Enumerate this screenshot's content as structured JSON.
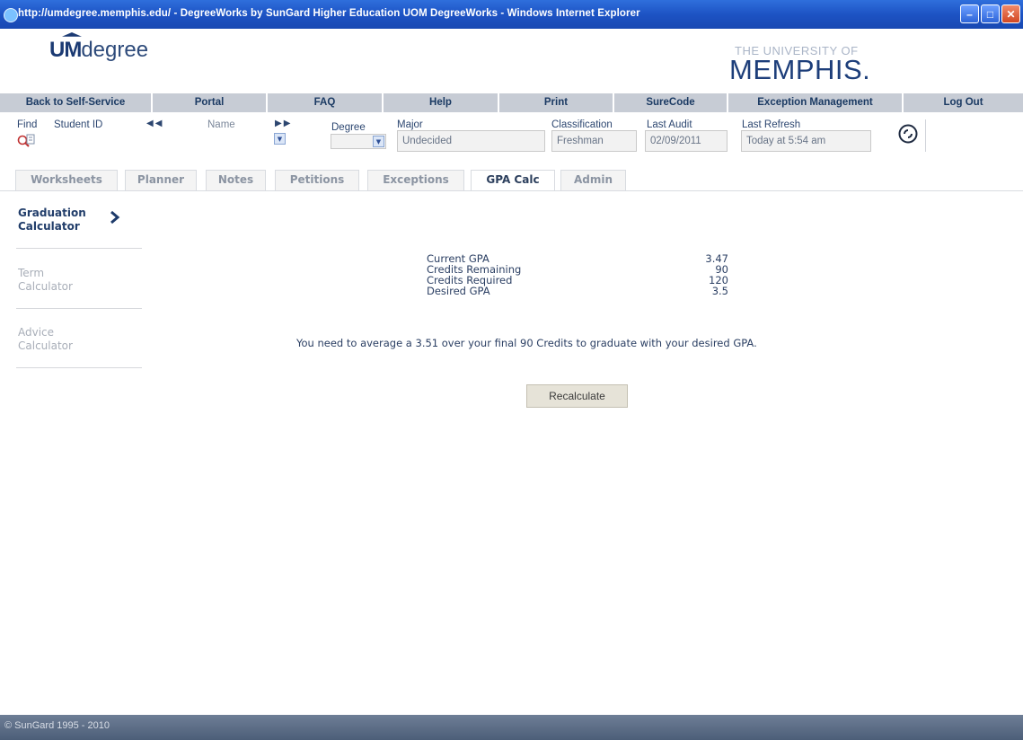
{
  "window": {
    "title": "http://umdegree.memphis.edu/ - DegreeWorks by SunGard Higher Education UOM DegreeWorks - Windows Internet Explorer",
    "buttons": [
      "minimize",
      "maximize",
      "close"
    ]
  },
  "header": {
    "logo_um": "UM",
    "logo_degree": "degree",
    "university_top": "THE UNIVERSITY OF",
    "university_name": "MEMPHIS."
  },
  "nav": {
    "items": [
      "Back to Self-Service",
      "Portal",
      "FAQ",
      "Help",
      "Print",
      "SureCode",
      "Exception Management",
      "Log Out"
    ]
  },
  "student": {
    "find_label": "Find",
    "student_id_label": "Student ID",
    "name_label": "Name",
    "degree_label": "Degree",
    "degree_value": "",
    "major_label": "Major",
    "major_value": "Undecided",
    "classification_label": "Classification",
    "classification_value": "Freshman",
    "last_audit_label": "Last Audit",
    "last_audit_value": "02/09/2011",
    "last_refresh_label": "Last Refresh",
    "last_refresh_value": "Today at 5:54 am"
  },
  "tabs": [
    "Worksheets",
    "Planner",
    "Notes",
    "Petitions",
    "Exceptions",
    "GPA Calc",
    "Admin"
  ],
  "active_tab": "GPA Calc",
  "left_menu": {
    "items": [
      {
        "line1": "Graduation",
        "line2": "Calculator",
        "active": true
      },
      {
        "line1": "Term",
        "line2": "Calculator",
        "active": false
      },
      {
        "line1": "Advice",
        "line2": "Calculator",
        "active": false
      }
    ]
  },
  "results": {
    "rows": [
      {
        "label": "Current GPA",
        "value": "3.47"
      },
      {
        "label": "Credits Remaining",
        "value": "90"
      },
      {
        "label": "Credits Required",
        "value": "120"
      },
      {
        "label": "Desired GPA",
        "value": "3.5"
      }
    ],
    "message": "You need to average a 3.51 over your final 90 Credits to graduate with your desired GPA.",
    "recalculate_label": "Recalculate"
  },
  "footer": {
    "text": "© SunGard 1995 - 2010"
  },
  "colors": {
    "titlebar": "#1d53c4",
    "nav_bg": "#c7ccd5",
    "brand": "#1d3e7a",
    "footer": "#5a6b84"
  }
}
